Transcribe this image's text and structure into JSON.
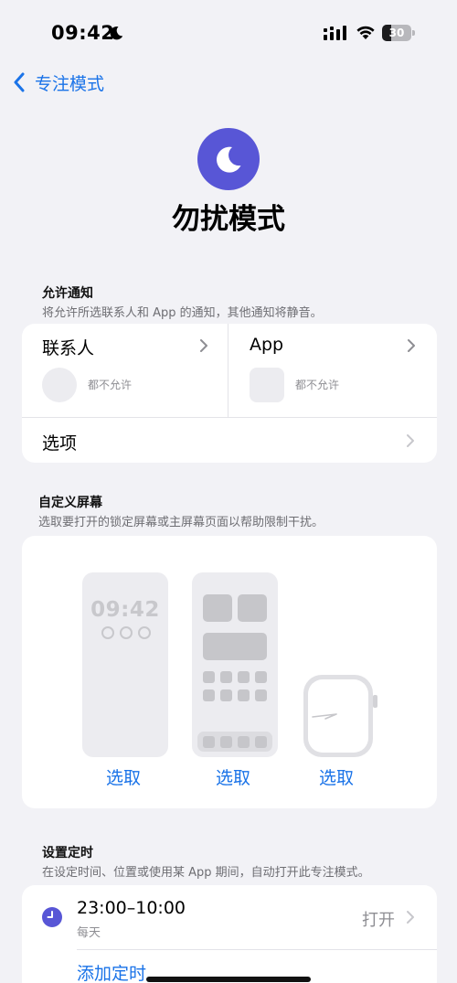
{
  "status_bar": {
    "time": "09:42",
    "focus_icon": "moon-icon",
    "signal_icon": "cellular-signal-icon",
    "wifi_icon": "wifi-icon",
    "battery_percent": "30",
    "battery_level": 0.3
  },
  "nav": {
    "back_label": "专注模式",
    "back_icon": "chevron-left-icon"
  },
  "header": {
    "icon": "moon-icon",
    "accent_color": "#5856d6",
    "title": "勿扰模式"
  },
  "allowed_notifications": {
    "title": "允许通知",
    "subtitle": "将允许所选联系人和 App 的通知，其他通知将静音。",
    "people": {
      "label": "联系人",
      "hint": "都不允许"
    },
    "apps": {
      "label": "App",
      "hint": "都不允许"
    },
    "options_label": "选项"
  },
  "customize_screens": {
    "title": "自定义屏幕",
    "subtitle": "选取要打开的锁定屏幕或主屏幕页面以帮助限制干扰。",
    "lock_screen_time": "09:42",
    "select_labels": [
      "选取",
      "选取",
      "选取"
    ]
  },
  "schedule": {
    "title": "设置定时",
    "subtitle": "在设定时间、位置或使用某 App 期间，自动打开此专注模式。",
    "item": {
      "icon": "clock-icon",
      "time_range": "23:00–10:00",
      "repeat": "每天",
      "status": "打开"
    },
    "add_label": "添加定时"
  },
  "colors": {
    "link": "#1a73e8",
    "background": "#f2f2f6",
    "focus_purple": "#5856d6"
  }
}
